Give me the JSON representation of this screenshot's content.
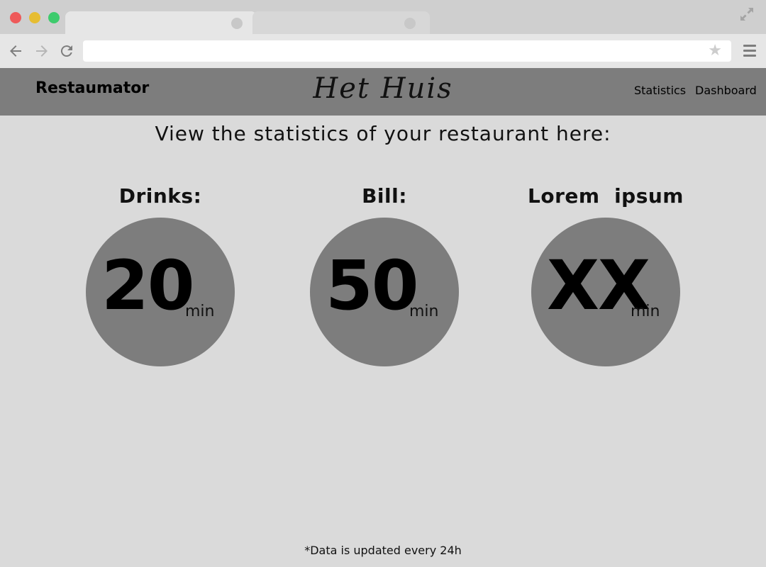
{
  "header": {
    "brand": "Restaumator",
    "restaurant_name": "Het Huis",
    "nav": [
      "Statistics",
      "Dashboard"
    ]
  },
  "main": {
    "title": "View the statistics of your restaurant here:",
    "stats": [
      {
        "label": "Drinks:",
        "value": "20",
        "unit": "min"
      },
      {
        "label": "Bill:",
        "value": "50",
        "unit": "min"
      },
      {
        "label": "Lorem  ipsum",
        "value": "XX",
        "unit": "min"
      }
    ],
    "footnote": "*Data is updated every 24h"
  },
  "colors": {
    "page_background": "#dadada",
    "header_background": "#7d7d7d",
    "circle_fill": "#7d7d7d"
  },
  "icons": [
    "back-arrow-icon",
    "forward-arrow-icon",
    "reload-icon",
    "star-icon",
    "menu-icon",
    "expand-icon"
  ]
}
